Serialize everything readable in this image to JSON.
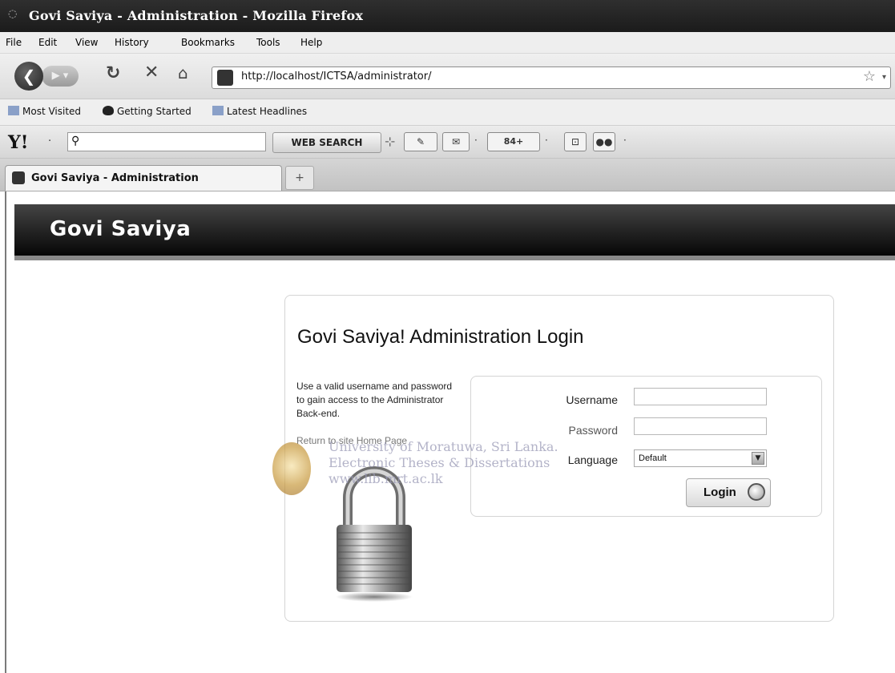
{
  "window": {
    "title": "Govi Saviya - Administration - Mozilla Firefox"
  },
  "menu": [
    "File",
    "Edit",
    "View",
    "History",
    "Bookmarks",
    "Tools",
    "Help"
  ],
  "nav": {
    "url": "http://localhost/ICTSA/administrator/"
  },
  "bookmarks": [
    "Most Visited",
    "Getting Started",
    "Latest Headlines"
  ],
  "yahoo_toolbar": {
    "logo": "Y!",
    "search_button": "WEB SEARCH",
    "mail_badge": "84+"
  },
  "tabs": [
    {
      "label": "Govi Saviya - Administration"
    }
  ],
  "site": {
    "banner_title": "Govi Saviya"
  },
  "login": {
    "title": "Govi Saviya! Administration Login",
    "help_text": "Use a valid username and password to gain access to the Administrator Back-end.",
    "return_link": "Return to site Home Page",
    "username_label": "Username",
    "username_value": "",
    "password_label": "Password",
    "password_value": "",
    "language_label": "Language",
    "language_selected": "Default",
    "login_button": "Login"
  },
  "watermark": {
    "line1": "University of Moratuwa, Sri Lanka.",
    "line2": "Electronic Theses & Dissertations",
    "line3": "www.lib.mrt.ac.lk"
  }
}
